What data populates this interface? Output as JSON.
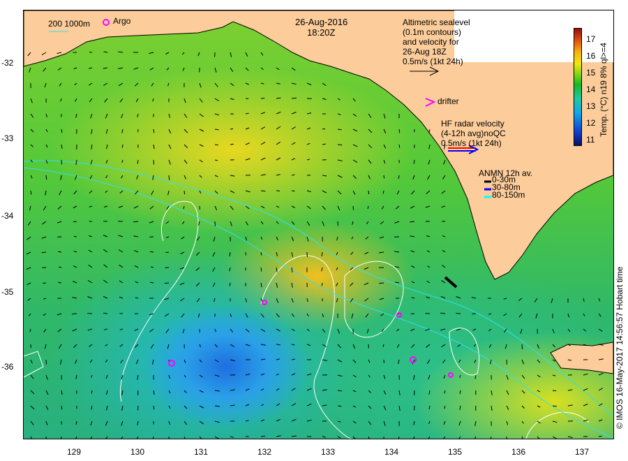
{
  "title": {
    "date": "26-Aug-2016",
    "time": "18:20Z"
  },
  "legend_left": {
    "depth_labels": "200  1000m",
    "argo_label": "Argo"
  },
  "altimetry": {
    "lines": [
      "Altimetric sealevel",
      "(0.1m contours)",
      "and velocity for",
      "26-Aug 18Z",
      "0.5m/s (1kt 24h)"
    ]
  },
  "drifter": {
    "label": "drifter"
  },
  "hf_radar": {
    "lines": [
      "HF radar velocity",
      "(4-12h avg)noQC",
      "0.5m/s (1kt 24h)"
    ]
  },
  "anmn": {
    "title": "ANMN 12h av.",
    "items": [
      {
        "label": "0-30m",
        "color": "#000000"
      },
      {
        "label": "30-80m",
        "color": "#0000ff"
      },
      {
        "label": "80-150m",
        "color": "#00ffff"
      }
    ]
  },
  "colorbar": {
    "ticks": [
      "17",
      "16",
      "15",
      "14",
      "13",
      "12",
      "11"
    ],
    "label": "Temp. (°C) n19 8% ql>=4"
  },
  "x_ticks": [
    "129",
    "130",
    "131",
    "132",
    "133",
    "134",
    "135",
    "136",
    "137"
  ],
  "y_ticks": [
    "-32",
    "-33",
    "-34",
    "-35",
    "-36"
  ],
  "copyright": "© IMOS 16-May-2017 14:56:57 Hobart time",
  "colors": {
    "land": "#fccc9a",
    "argo": "#ff00ff"
  }
}
